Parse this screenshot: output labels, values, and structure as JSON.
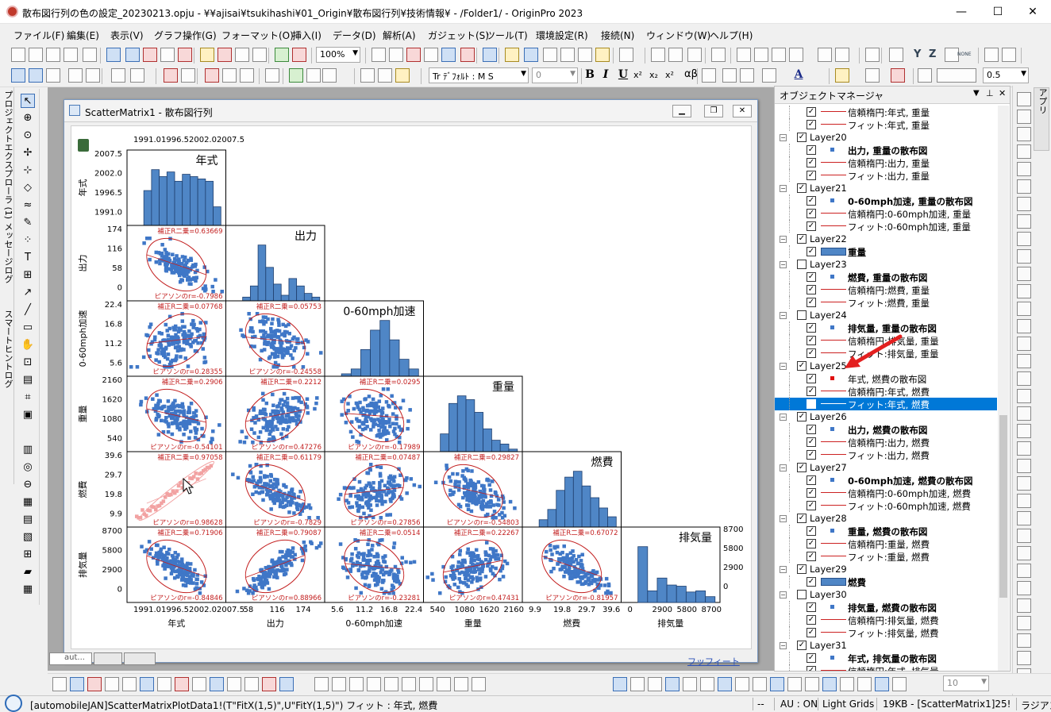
{
  "window": {
    "title": "散布図行列の色の設定_20230213.opju - ¥¥ajisai¥tsukihashi¥01_Origin¥散布図行列¥技術情報¥ - /Folder1/ - OriginPro 2023",
    "minimize": "—",
    "maximize": "☐",
    "close": "✕"
  },
  "menu": [
    "ファイル(F)",
    "編集(E)",
    "表示(V)",
    "グラフ操作(G)",
    "フォーマット(O)",
    "挿入(I)",
    "データ(D)",
    "解析(A)",
    "ガジェット(S)",
    "ツール(T)",
    "環境設定(R)",
    "接続(N)",
    "ウィンドウ(W)",
    "ヘルプ(H)"
  ],
  "toolbar": {
    "zoom_value": "100%",
    "font_value": "Tr ﾃﾞﾌｫﾙﾄ : M S",
    "font_size_value": "0",
    "bold": "B",
    "italic": "I",
    "underline": "U",
    "superscript": "x²",
    "subscript": "x₂",
    "superscript2": "x²",
    "greek": "αβ",
    "font_color_letter": "A",
    "line_width_value": "0.5",
    "zoom_letters": [
      "Y",
      "Z"
    ],
    "none_label": "NONE"
  },
  "left_tabs": [
    "プロジェクトエクスプローラ (1)",
    "メッセージログ",
    "スマートヒントログ"
  ],
  "graph_window": {
    "title": "ScatterMatrix1 - 散布図行列",
    "bottom_tabs": [
      "aut...",
      "",
      ""
    ],
    "footer_link": "フッフィート"
  },
  "chart_data": {
    "type": "scatter",
    "variables": [
      "年式",
      "出力",
      "0-60mph加速",
      "重量",
      "燃費",
      "排気量"
    ],
    "diag_titles": [
      "年式",
      "出力",
      "0-60mph加速",
      "重量",
      "燃費",
      "排気量"
    ],
    "axis_ticks": {
      "年式": [
        "1991.0",
        "1996.5",
        "2002.0",
        "2007.5"
      ],
      "出力": [
        "0",
        "58",
        "116",
        "174"
      ],
      "0-60mph加速": [
        "5.6",
        "11.2",
        "16.8",
        "22.4"
      ],
      "重量": [
        "540",
        "1080",
        "1620",
        "2160"
      ],
      "燃費": [
        "9.9",
        "19.8",
        "29.7",
        "39.6"
      ],
      "排気量": [
        "0",
        "2900",
        "5800",
        "8700"
      ]
    },
    "bottom_tick_labels": {
      "年式": "1991.01996.52002.02007.5",
      "出力": [
        "58",
        "116",
        "174"
      ],
      "0-60mph加速": [
        "5.6",
        "11.2",
        "16.8",
        "22.4"
      ],
      "重量": [
        "540",
        "1080",
        "1620",
        "2160"
      ],
      "燃費": [
        "9.9",
        "19.8",
        "29.7",
        "39.6"
      ],
      "排気量": [
        "0",
        "2900",
        "5800",
        "8700"
      ]
    },
    "top_tick_label": "1991.01996.52002.02007.5",
    "left_tick_labels": {
      "年式": [
        "2007.5",
        "2002.0",
        "1996.5",
        "1991.0"
      ],
      "出力": [
        "174",
        "116",
        "58",
        "0"
      ],
      "0-60mph加速": [
        "22.4",
        "16.8",
        "11.2",
        "5.6"
      ],
      "重量": [
        "2160",
        "1620",
        "1080",
        "540"
      ],
      "燃費": [
        "39.6",
        "29.7",
        "19.8",
        "9.9"
      ],
      "排気量": [
        "8700",
        "5800",
        "2900",
        "0"
      ]
    },
    "right_tick_labels": [
      "8700",
      "5800",
      "2900",
      "0"
    ],
    "histograms": {
      "年式": [
        15,
        24,
        21,
        23,
        19,
        22,
        21,
        20,
        19,
        8
      ],
      "出力": [
        2,
        8,
        30,
        18,
        9,
        3,
        12,
        8,
        4,
        2
      ],
      "0-60mph加速": [
        2,
        6,
        22,
        38,
        46,
        30,
        14,
        6
      ],
      "重量": [
        14,
        38,
        44,
        41,
        31,
        18,
        9,
        6,
        2
      ],
      "燃費": [
        5,
        12,
        25,
        34,
        38,
        28,
        20,
        13,
        7
      ],
      "排気量": [
        48,
        10,
        21,
        15,
        14,
        9,
        10,
        5
      ]
    },
    "cells": [
      {
        "row": 1,
        "col": 0,
        "r2": "補正R二乗=0.63669",
        "r": "ピアソンのr=-0.7986"
      },
      {
        "row": 2,
        "col": 0,
        "r2": "補正R二乗=0.07768",
        "r": "ピアソンのr=0.28355"
      },
      {
        "row": 2,
        "col": 1,
        "r2": "補正R二乗=0.05753",
        "r": "ピアソンのr=-0.24558"
      },
      {
        "row": 3,
        "col": 0,
        "r2": "補正R二乗=0.2906",
        "r": "ピアソンのr=-0.54101"
      },
      {
        "row": 3,
        "col": 1,
        "r2": "補正R二乗=0.2212",
        "r": "ピアソンのr=0.47276"
      },
      {
        "row": 3,
        "col": 2,
        "r2": "補正R二乗=0.0295",
        "r": "ピアソンのr=-0.17989"
      },
      {
        "row": 4,
        "col": 0,
        "r2": "補正R二乗=0.97058",
        "r": "ピアソンのr=0.98628"
      },
      {
        "row": 4,
        "col": 1,
        "r2": "補正R二乗=0.61179",
        "r": "ピアソンのr=-0.7829"
      },
      {
        "row": 4,
        "col": 2,
        "r2": "補正R二乗=0.07487",
        "r": "ピアソンのr=0.27856"
      },
      {
        "row": 4,
        "col": 3,
        "r2": "補正R二乗=0.29827",
        "r": "ピアソンのr=-0.54803"
      },
      {
        "row": 5,
        "col": 0,
        "r2": "補正R二乗=0.71906",
        "r": "ピアソンのr=-0.84846"
      },
      {
        "row": 5,
        "col": 1,
        "r2": "補正R二乗=0.79087",
        "r": "ピアソンのr=0.88966"
      },
      {
        "row": 5,
        "col": 2,
        "r2": "補正R二乗=0.0514",
        "r": "ピアソンのr=-0.23281"
      },
      {
        "row": 5,
        "col": 3,
        "r2": "補正R二乗=0.22267",
        "r": "ピアソンのr=0.47431"
      },
      {
        "row": 5,
        "col": 4,
        "r2": "補正R二乗=0.67072",
        "r": "ピアソンのr=-0.81957"
      }
    ],
    "colors": {
      "points": "#3f77c7",
      "hist": "#4f86c6",
      "ellipse": "#c32020",
      "text_red": "#c32020",
      "highlight": "#f2a2a2"
    }
  },
  "object_manager": {
    "title": "オブジェクトマネージャ",
    "rows": [
      {
        "indent": 2,
        "sym": "line",
        "label": "信頼楕円:年式, 重量"
      },
      {
        "indent": 2,
        "sym": "line",
        "label": "フィット:年式, 重量"
      },
      {
        "indent": 0,
        "sym": "none",
        "label": "Layer20",
        "checked": true
      },
      {
        "indent": 2,
        "sym": "dot",
        "label": "出力, 重量の散布図",
        "bold": true
      },
      {
        "indent": 2,
        "sym": "line",
        "label": "信頼楕円:出力, 重量"
      },
      {
        "indent": 2,
        "sym": "line",
        "label": "フィット:出力, 重量"
      },
      {
        "indent": 0,
        "sym": "none",
        "label": "Layer21",
        "checked": true
      },
      {
        "indent": 2,
        "sym": "dot",
        "label": "0-60mph加速, 重量の散布図",
        "bold": true
      },
      {
        "indent": 2,
        "sym": "line",
        "label": "信頼楕円:0-60mph加速, 重量"
      },
      {
        "indent": 2,
        "sym": "line",
        "label": "フィット:0-60mph加速, 重量"
      },
      {
        "indent": 0,
        "sym": "none",
        "label": "Layer22",
        "checked": true
      },
      {
        "indent": 2,
        "sym": "bar",
        "label": "重量",
        "bold": true
      },
      {
        "indent": 0,
        "sym": "none",
        "label": "Layer23",
        "checked": false
      },
      {
        "indent": 2,
        "sym": "dot",
        "label": "燃費, 重量の散布図",
        "bold": true
      },
      {
        "indent": 2,
        "sym": "line",
        "label": "信頼楕円:燃費, 重量"
      },
      {
        "indent": 2,
        "sym": "line",
        "label": "フィット:燃費, 重量"
      },
      {
        "indent": 0,
        "sym": "none",
        "label": "Layer24",
        "checked": false
      },
      {
        "indent": 2,
        "sym": "dot",
        "label": "排気量, 重量の散布図",
        "bold": true
      },
      {
        "indent": 2,
        "sym": "line",
        "label": "信頼楕円:排気量, 重量"
      },
      {
        "indent": 2,
        "sym": "line",
        "label": "フィット:排気量, 重量"
      },
      {
        "indent": 0,
        "sym": "none",
        "label": "Layer25",
        "checked": true
      },
      {
        "indent": 2,
        "sym": "reddot",
        "label": "年式, 燃費の散布図"
      },
      {
        "indent": 2,
        "sym": "line",
        "label": "信頼楕円:年式, 燃費"
      },
      {
        "indent": 2,
        "sym": "line",
        "label": "フィット:年式, 燃費",
        "selected": true
      },
      {
        "indent": 0,
        "sym": "none",
        "label": "Layer26",
        "checked": true
      },
      {
        "indent": 2,
        "sym": "dot",
        "label": "出力, 燃費の散布図",
        "bold": true
      },
      {
        "indent": 2,
        "sym": "line",
        "label": "信頼楕円:出力, 燃費"
      },
      {
        "indent": 2,
        "sym": "line",
        "label": "フィット:出力, 燃費"
      },
      {
        "indent": 0,
        "sym": "none",
        "label": "Layer27",
        "checked": true
      },
      {
        "indent": 2,
        "sym": "dot",
        "label": "0-60mph加速, 燃費の散布図",
        "bold": true
      },
      {
        "indent": 2,
        "sym": "line",
        "label": "信頼楕円:0-60mph加速, 燃費"
      },
      {
        "indent": 2,
        "sym": "line",
        "label": "フィット:0-60mph加速, 燃費"
      },
      {
        "indent": 0,
        "sym": "none",
        "label": "Layer28",
        "checked": true
      },
      {
        "indent": 2,
        "sym": "dot",
        "label": "重量, 燃費の散布図",
        "bold": true
      },
      {
        "indent": 2,
        "sym": "line",
        "label": "信頼楕円:重量, 燃費"
      },
      {
        "indent": 2,
        "sym": "line",
        "label": "フィット:重量, 燃費"
      },
      {
        "indent": 0,
        "sym": "none",
        "label": "Layer29",
        "checked": true
      },
      {
        "indent": 2,
        "sym": "bar",
        "label": "燃費",
        "bold": true
      },
      {
        "indent": 0,
        "sym": "none",
        "label": "Layer30",
        "checked": false
      },
      {
        "indent": 2,
        "sym": "dot",
        "label": "排気量, 燃費の散布図",
        "bold": true
      },
      {
        "indent": 2,
        "sym": "line",
        "label": "信頼楕円:排気量, 燃費"
      },
      {
        "indent": 2,
        "sym": "line",
        "label": "フィット:排気量, 燃費"
      },
      {
        "indent": 0,
        "sym": "none",
        "label": "Layer31",
        "checked": true
      },
      {
        "indent": 2,
        "sym": "dot",
        "label": "年式, 排気量の散布図",
        "bold": true
      },
      {
        "indent": 2,
        "sym": "line",
        "label": "信頼楕円:年式, 排気量"
      }
    ]
  },
  "right_strip": {
    "tab_label": "アプリ"
  },
  "bottom_toolbar": {
    "size_value": "10"
  },
  "status": {
    "message": "[automobileJAN]ScatterMatrixPlotData1!(T\"FitX(1,5)\",U\"FitY(1,5)\") フィット : 年式, 燃費",
    "dash": "--",
    "au": "AU : ON",
    "theme": "Light Grids",
    "info": "19KB - [ScatterMatrix1]25!",
    "unit": "ラジアン"
  }
}
